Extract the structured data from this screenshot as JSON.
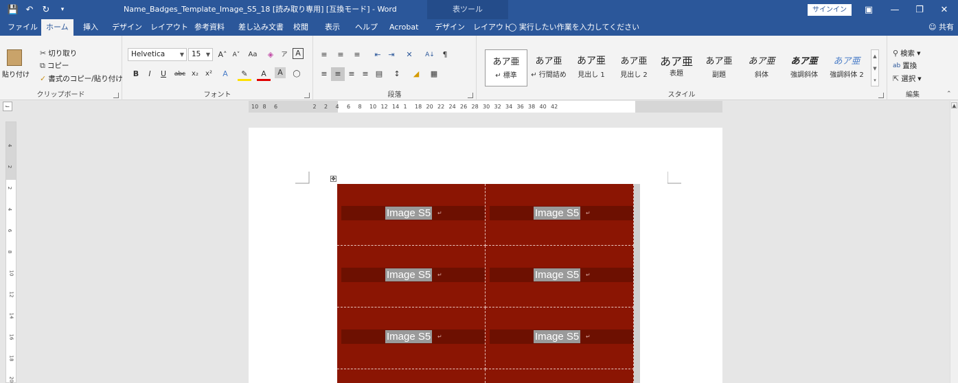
{
  "titlebar": {
    "doc_title": "Name_Badges_Template_Image_S5_18 [読み取り専用] [互換モード] - Word",
    "context_tab_group": "表ツール",
    "signin": "サインイン"
  },
  "tabs": [
    {
      "label": "ファイル",
      "active": false
    },
    {
      "label": "ホーム",
      "active": true
    },
    {
      "label": "挿入",
      "active": false
    },
    {
      "label": "デザイン",
      "active": false
    },
    {
      "label": "レイアウト",
      "active": false
    },
    {
      "label": "参考資料",
      "active": false
    },
    {
      "label": "差し込み文書",
      "active": false
    },
    {
      "label": "校閲",
      "active": false
    },
    {
      "label": "表示",
      "active": false
    },
    {
      "label": "ヘルプ",
      "active": false
    },
    {
      "label": "Acrobat",
      "active": false
    },
    {
      "label": "デザイン",
      "active": false
    },
    {
      "label": "レイアウト",
      "active": false
    }
  ],
  "tellme": "実行したい作業を入力してください",
  "share": "共有",
  "clipboard": {
    "paste": "貼り付け",
    "cut": "切り取り",
    "copy": "コピー",
    "format_painter": "書式のコピー/貼り付け",
    "group_label": "クリップボード"
  },
  "font": {
    "font_name": "Helvetica",
    "font_size": "15",
    "group_label": "フォント"
  },
  "paragraph": {
    "group_label": "段落"
  },
  "styles": {
    "group_label": "スタイル",
    "items": [
      {
        "sample": "あア亜",
        "name": "↵ 標準",
        "selected": true
      },
      {
        "sample": "あア亜",
        "name": "↵ 行間詰め",
        "selected": false
      },
      {
        "sample": "あア亜",
        "name": "見出し 1",
        "selected": false
      },
      {
        "sample": "あア亜",
        "name": "見出し 2",
        "selected": false
      },
      {
        "sample": "あア亜",
        "name": "表題",
        "selected": false
      },
      {
        "sample": "あア亜",
        "name": "副題",
        "selected": false
      },
      {
        "sample": "あア亜",
        "name": "斜体",
        "selected": false
      },
      {
        "sample": "あア亜",
        "name": "強調斜体",
        "selected": false
      },
      {
        "sample": "あア亜",
        "name": "強調斜体 2",
        "selected": false
      }
    ]
  },
  "editing": {
    "find": "検索",
    "replace": "置換",
    "select": "選択",
    "group_label": "編集"
  },
  "hruler_ticks": [
    "10",
    "8",
    "6",
    "2",
    "2",
    "4",
    "6",
    "8",
    "10",
    "12",
    "14",
    "1",
    "18",
    "20",
    "22",
    "24",
    "26",
    "28",
    "30",
    "32",
    "34",
    "36",
    "38",
    "40",
    "42"
  ],
  "vruler_ticks": [
    "4",
    "2",
    "2",
    "4",
    "6",
    "8",
    "10",
    "12",
    "14",
    "16",
    "18",
    "20"
  ],
  "badges": {
    "rows": 3,
    "cols": 2,
    "label": "Image S5",
    "colors": {
      "cell_bg": "#8b1503",
      "band_bg": "#6d1001",
      "label_highlight": "#9a9a9a"
    }
  },
  "colors": {
    "brand": "#2b579a",
    "ribbon_bg": "#f3f3f3"
  }
}
